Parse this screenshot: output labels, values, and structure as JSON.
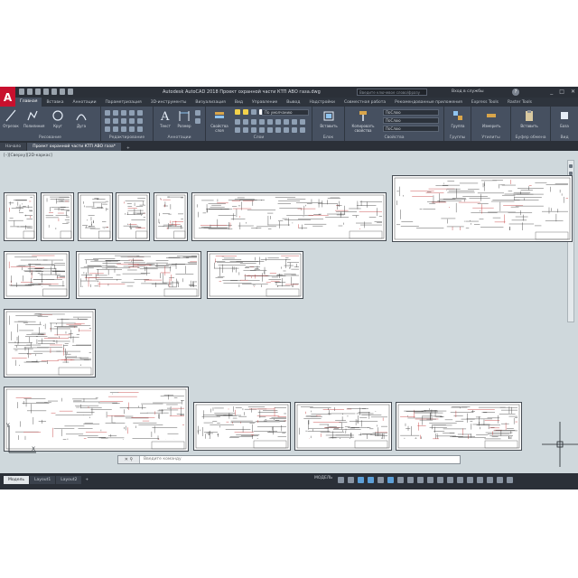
{
  "app": {
    "logo_letter": "A",
    "window_title": "Autodesk AutoCAD 2018   Проект охранной части КТП АВО газа.dwg",
    "search_placeholder": "Введите ключевое слово/фразу",
    "sign_in": "Вход в службы",
    "help": "?",
    "window_controls": [
      "_",
      "□",
      "✕"
    ]
  },
  "ribbon_tabs": [
    "Главная",
    "Вставка",
    "Аннотации",
    "Параметризация",
    "3D-инструменты",
    "Визуализация",
    "Вид",
    "Управление",
    "Вывод",
    "Надстройки",
    "Совместная работа",
    "Рекомендованные приложения",
    "Express Tools",
    "Raster Tools"
  ],
  "ribbon": {
    "draw": {
      "label": "Рисование",
      "buttons": [
        "Отрезок",
        "Полилиния",
        "Круг",
        "Дуга"
      ]
    },
    "modify": {
      "label": "Редактирование"
    },
    "annotation": {
      "label": "Аннотации",
      "buttons": [
        "Текст",
        "Размер"
      ]
    },
    "layers": {
      "label": "Слои",
      "button": "Свойства слоя",
      "layer_dropdown": "По умолчанию"
    },
    "block": {
      "label": "Блок",
      "button": "Вставить"
    },
    "properties": {
      "label": "Свойства",
      "button": "Копировать свойства",
      "color": "ПоСлою",
      "lineweight": "ПоСлою",
      "linetype": "ПоСлою"
    },
    "groups": {
      "label": "Группы",
      "button": "Группа"
    },
    "utilities": {
      "label": "Утилиты",
      "button": "Измерить"
    },
    "clipboard": {
      "label": "Буфер обмена",
      "button": "Вставить"
    },
    "view": {
      "label": "Вид",
      "button": "База"
    }
  },
  "file_tabs": {
    "start": "Начало",
    "active": "Проект охранной части КТП АВО газа*",
    "plus": "+"
  },
  "viewport_label": "[–][Сверху][2D-каркас]",
  "command_line": {
    "icons": "✕ ⚲",
    "prompt": "Введите команду"
  },
  "layout_tabs": {
    "model": "Модель",
    "layout1": "Layout1",
    "layout2": "Layout2",
    "plus": "+"
  },
  "status": {
    "model_button": "МОДЕЛЬ"
  },
  "colors": {
    "ribbon_bg": "#465060",
    "canvas_bg": "#cfd8dc",
    "logo_red": "#c8102e",
    "titlebar_bg": "#2b3038"
  }
}
